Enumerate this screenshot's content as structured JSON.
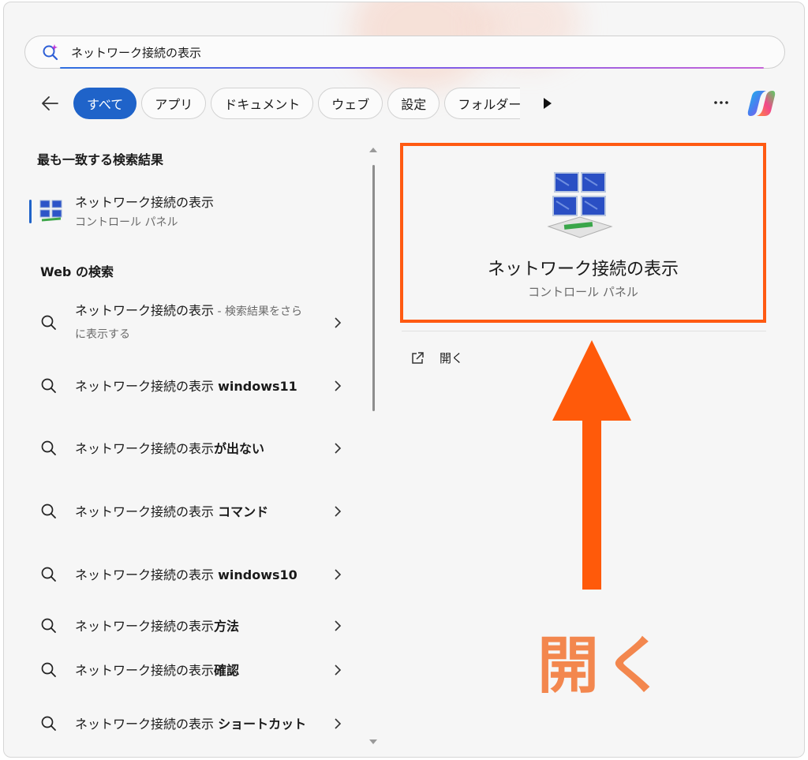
{
  "search": {
    "query": "ネットワーク接続の表示"
  },
  "filters": {
    "chips": [
      {
        "label": "すべて",
        "active": true
      },
      {
        "label": "アプリ",
        "active": false
      },
      {
        "label": "ドキュメント",
        "active": false
      },
      {
        "label": "ウェブ",
        "active": false
      },
      {
        "label": "設定",
        "active": false
      },
      {
        "label": "フォルダー",
        "active": false
      }
    ]
  },
  "best_match": {
    "heading": "最も一致する検索結果",
    "title": "ネットワーク接続の表示",
    "subtitle": "コントロール パネル"
  },
  "web_search": {
    "heading": "Web の検索",
    "items": [
      {
        "normal": "ネットワーク接続の表示",
        "bold": "",
        "grey": " - 検索結果をさらに表示する"
      },
      {
        "normal": "ネットワーク接続の表示 ",
        "bold": "windows11",
        "grey": ""
      },
      {
        "normal": "ネットワーク接続の表示",
        "bold": "が出ない",
        "grey": ""
      },
      {
        "normal": "ネットワーク接続の表示 ",
        "bold": "コマンド",
        "grey": ""
      },
      {
        "normal": "ネットワーク接続の表示 ",
        "bold": "windows10",
        "grey": ""
      },
      {
        "normal": "ネットワーク接続の表示",
        "bold": "方法",
        "grey": ""
      },
      {
        "normal": "ネットワーク接続の表示",
        "bold": "確認",
        "grey": ""
      },
      {
        "normal": "ネットワーク接続の表示 ",
        "bold": "ショートカット",
        "grey": ""
      }
    ]
  },
  "preview": {
    "title": "ネットワーク接続の表示",
    "subtitle": "コントロール パネル",
    "open_label": "開く"
  },
  "annotation": {
    "text": "開く",
    "color": "#f3874e",
    "arrow_color": "#ff5a0a",
    "box_color": "#ff5a12"
  },
  "colors": {
    "accent": "#1f63c9"
  }
}
